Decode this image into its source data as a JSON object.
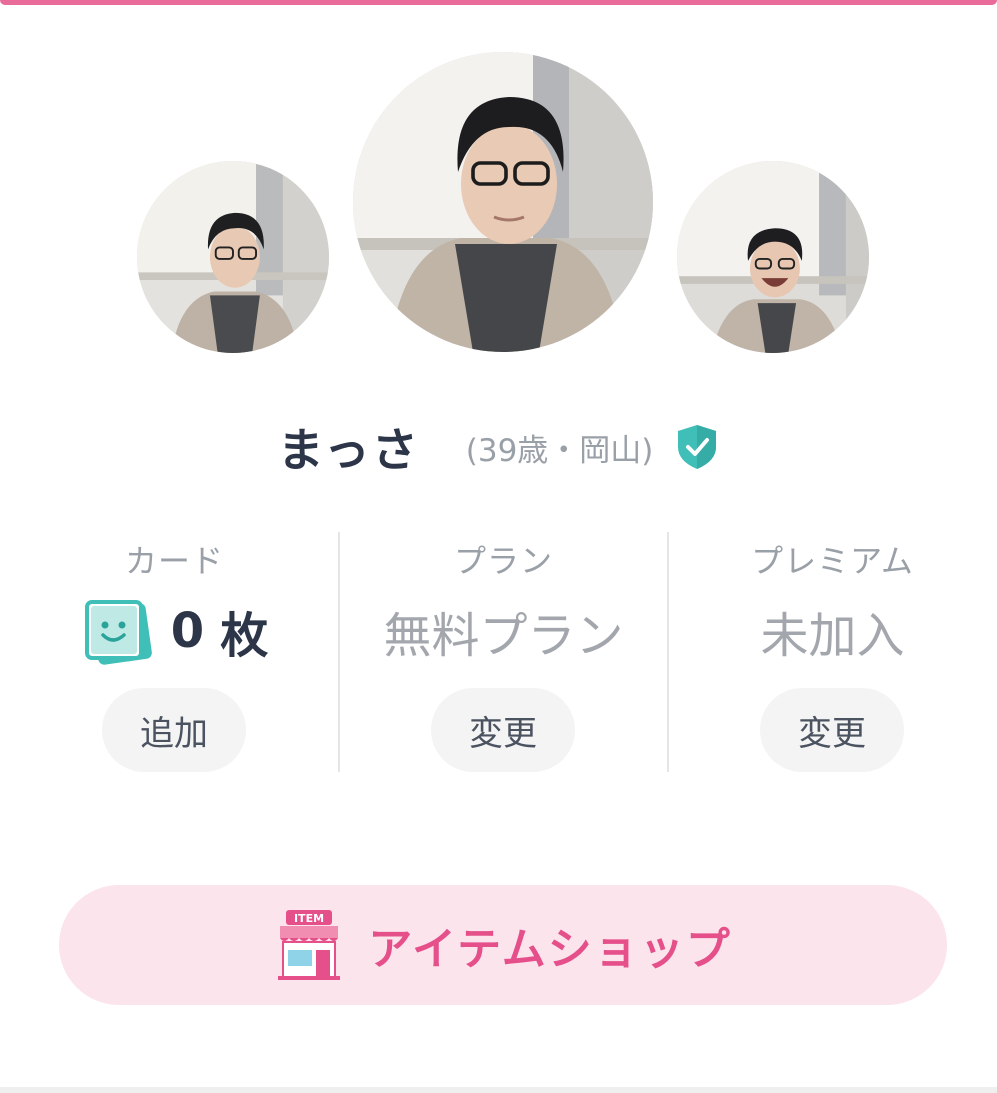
{
  "colors": {
    "accent": "#e96b99",
    "shop_text": "#e5508a",
    "shop_bg": "#fce4ed",
    "verified": "#3fbfb8",
    "name_text": "#2c3648",
    "muted_text": "#9aa0a8"
  },
  "profile": {
    "name": "まっさ",
    "meta": "(39歳・岡山)",
    "verified_icon": "shield-check-icon",
    "photos": [
      {
        "label": "profile-photo-1",
        "expression": "neutral"
      },
      {
        "label": "profile-photo-2",
        "expression": "neutral"
      },
      {
        "label": "profile-photo-3",
        "expression": "laughing"
      }
    ]
  },
  "stats": {
    "card": {
      "label": "カード",
      "count": "0",
      "unit": "枚",
      "icon": "card-face-icon",
      "button": "追加"
    },
    "plan": {
      "label": "プラン",
      "value": "無料プラン",
      "button": "変更"
    },
    "premium": {
      "label": "プレミアム",
      "value": "未加入",
      "button": "変更"
    }
  },
  "shop": {
    "label": "アイテムショップ",
    "icon": "item-shop-icon",
    "icon_sign": "ITEM"
  }
}
